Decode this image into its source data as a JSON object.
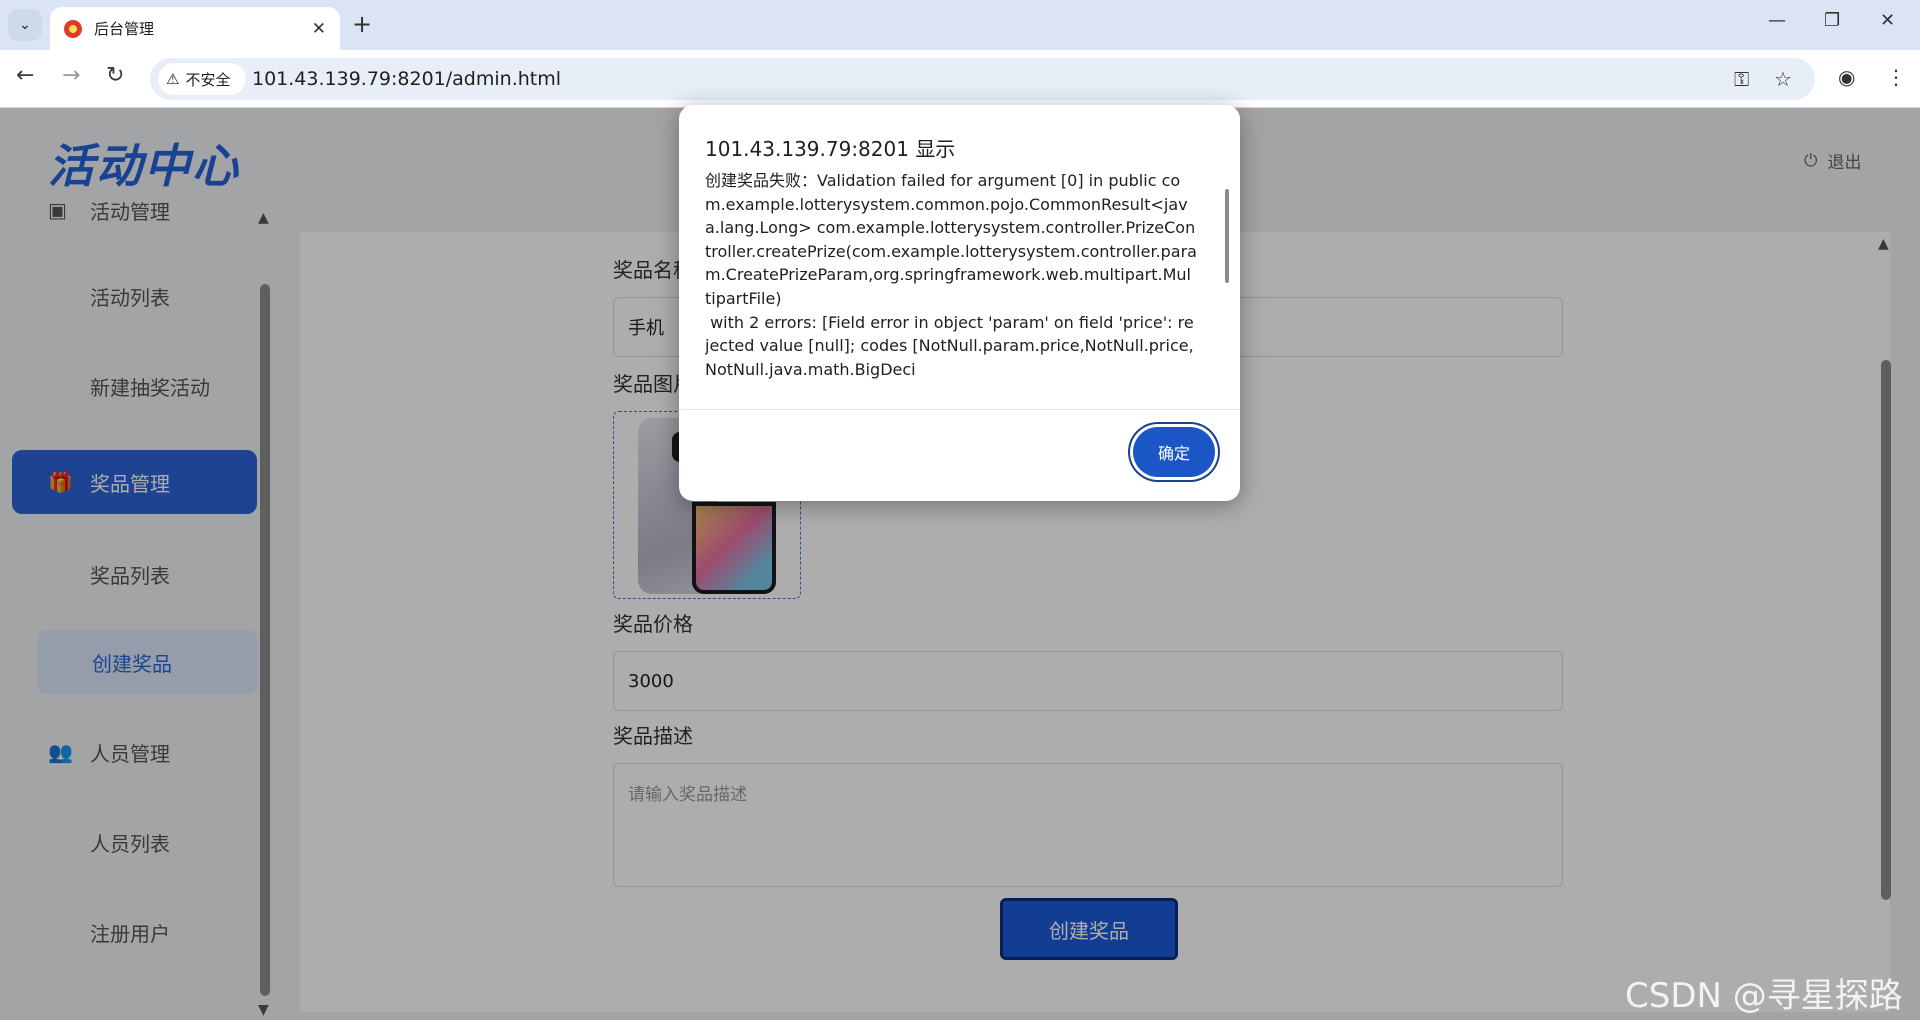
{
  "browser": {
    "tab_title": "后台管理",
    "tab_close": "✕",
    "new_tab": "+",
    "security_label": "不安全",
    "url": "101.43.139.79:8201/admin.html",
    "window_controls": [
      "—",
      "❐",
      "✕"
    ]
  },
  "header": {
    "brand": "活动中心",
    "logout_label": "退出"
  },
  "sidebar": {
    "items": [
      {
        "label": "活动管理",
        "icon": "box-icon"
      },
      {
        "label": "活动列表"
      },
      {
        "label": "新建抽奖活动"
      },
      {
        "label": "奖品管理",
        "icon": "gift-icon",
        "state": "active"
      },
      {
        "label": "奖品列表"
      },
      {
        "label": "创建奖品",
        "state": "selected"
      },
      {
        "label": "人员管理",
        "icon": "users-icon"
      },
      {
        "label": "人员列表"
      },
      {
        "label": "注册用户"
      }
    ]
  },
  "form": {
    "name_label": "奖品名称",
    "name_value": "手机",
    "image_label": "奖品图片",
    "price_label": "奖品价格",
    "price_value": "3000",
    "desc_label": "奖品描述",
    "desc_placeholder": "请输入奖品描述",
    "submit_label": "创建奖品"
  },
  "dialog": {
    "title": "101.43.139.79:8201 显示",
    "message": "创建奖品失败：Validation failed for argument [0] in public com.example.lotterysystem.common.pojo.CommonResult<java.lang.Long> com.example.lotterysystem.controller.PrizeController.createPrize(com.example.lotterysystem.controller.param.CreatePrizeParam,org.springframework.web.multipart.MultipartFile)\n with 2 errors: [Field error in object 'param' on field 'price': rejected value [null]; codes [NotNull.param.price,NotNull.price,NotNull.java.math.BigDeci",
    "ok_label": "确定"
  },
  "watermark": "CSDN @寻星探路",
  "colors": {
    "accent": "#2b63d8",
    "button": "#1a56c6"
  }
}
